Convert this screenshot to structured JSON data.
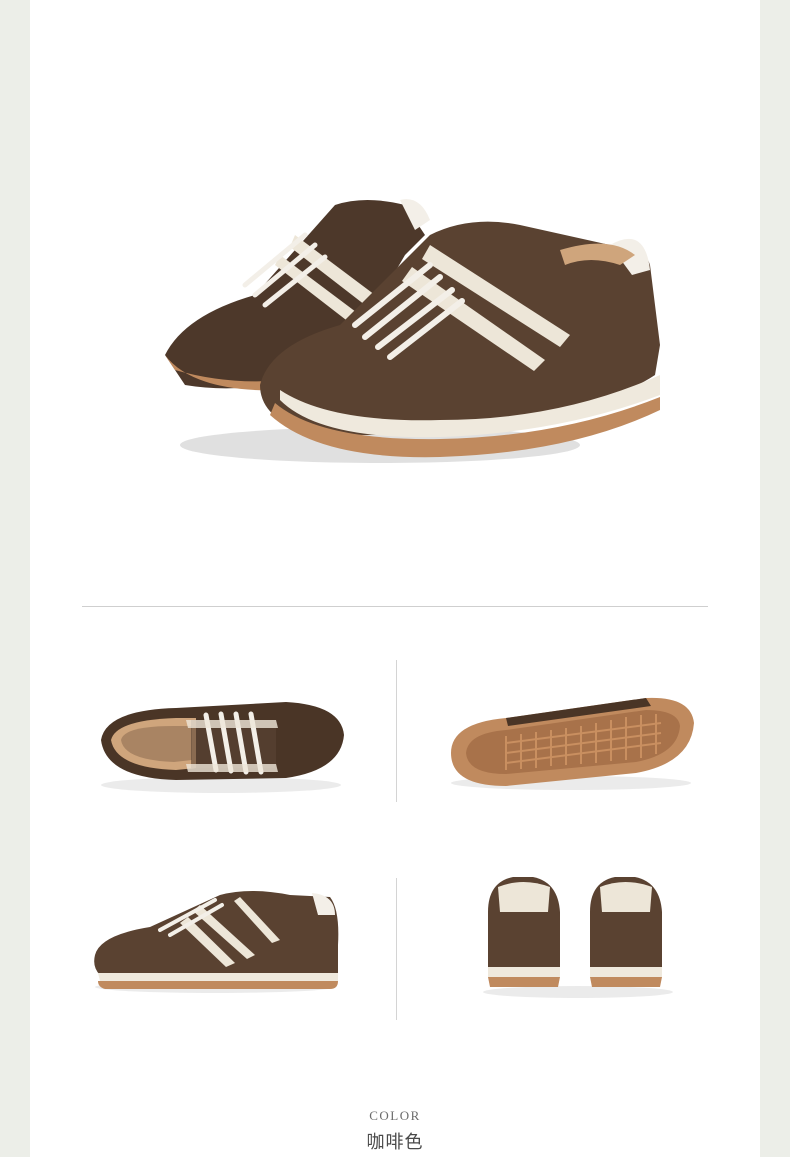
{
  "color_section": {
    "label": "COLOR",
    "name": "咖啡色"
  },
  "palette": {
    "upper": "#4a3526",
    "suede": "#5b4332",
    "stripe": "#ede6d8",
    "sole": "#c08a5e",
    "midsole": "#efe9dd",
    "lining": "#cfa57c"
  },
  "views": [
    "hero-pair",
    "top-view",
    "outsole-view",
    "side-view",
    "back-view"
  ]
}
